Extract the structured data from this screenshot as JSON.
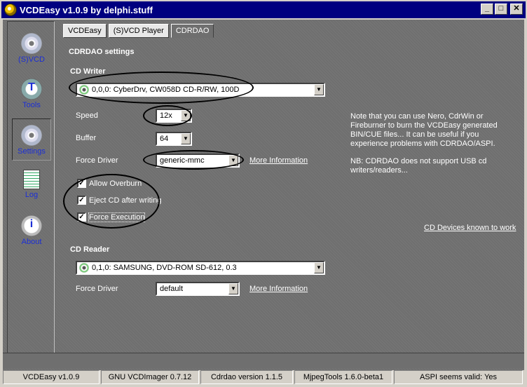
{
  "window": {
    "title": "VCDEasy v1.0.9 by delphi.stuff",
    "buttons": {
      "minimize": "_",
      "maximize": "□",
      "close": "✕"
    }
  },
  "sidebar": {
    "items": [
      {
        "label": "(S)VCD",
        "icon": "cd-icon",
        "badge": "SVCD"
      },
      {
        "label": "Tools",
        "icon": "tools-icon"
      },
      {
        "label": "Settings",
        "icon": "cd-settings-icon"
      },
      {
        "label": "Log",
        "icon": "log-icon"
      },
      {
        "label": "About",
        "icon": "info-icon"
      }
    ]
  },
  "tabs": [
    {
      "label": "VCDEasy"
    },
    {
      "label": "(S)VCD Player"
    },
    {
      "label": "CDRDAO"
    }
  ],
  "settings": {
    "title": "CDRDAO settings",
    "writer": {
      "header": "CD Writer",
      "device": "0,0,0: CyberDrv, CW058D CD-R/RW, 100D",
      "speed_label": "Speed",
      "speed": "12x",
      "buffer_label": "Buffer",
      "buffer": "64",
      "force_driver_label": "Force Driver",
      "force_driver": "generic-mmc",
      "more_info": "More Information",
      "allow_overburn": "Allow Overburn",
      "eject": "Eject CD after writing",
      "force_execution": "Force Execution"
    },
    "note1": "Note that you can use Nero, CdrWin or Fireburner to burn the VCDEasy generated BIN/CUE files... It can be useful if you experience problems with CDRDAO/ASPI.",
    "note2": "NB: CDRDAO does not support USB cd writers/readers...",
    "devices_link": "CD Devices known to work",
    "reader": {
      "header": "CD Reader",
      "device": "0,1,0: SAMSUNG, DVD-ROM SD-612, 0.3",
      "force_driver_label": "Force Driver",
      "force_driver": "default",
      "more_info": "More Information"
    }
  },
  "status": [
    "VCDEasy v1.0.9",
    "GNU VCDImager 0.7.12",
    "Cdrdao version 1.1.5",
    "MjpegTools 1.6.0-beta1",
    "ASPI seems valid: Yes"
  ],
  "colors": {
    "titlebar": "#000080",
    "panel": "#6f6f6f",
    "nav_text": "#1c2fd6"
  }
}
